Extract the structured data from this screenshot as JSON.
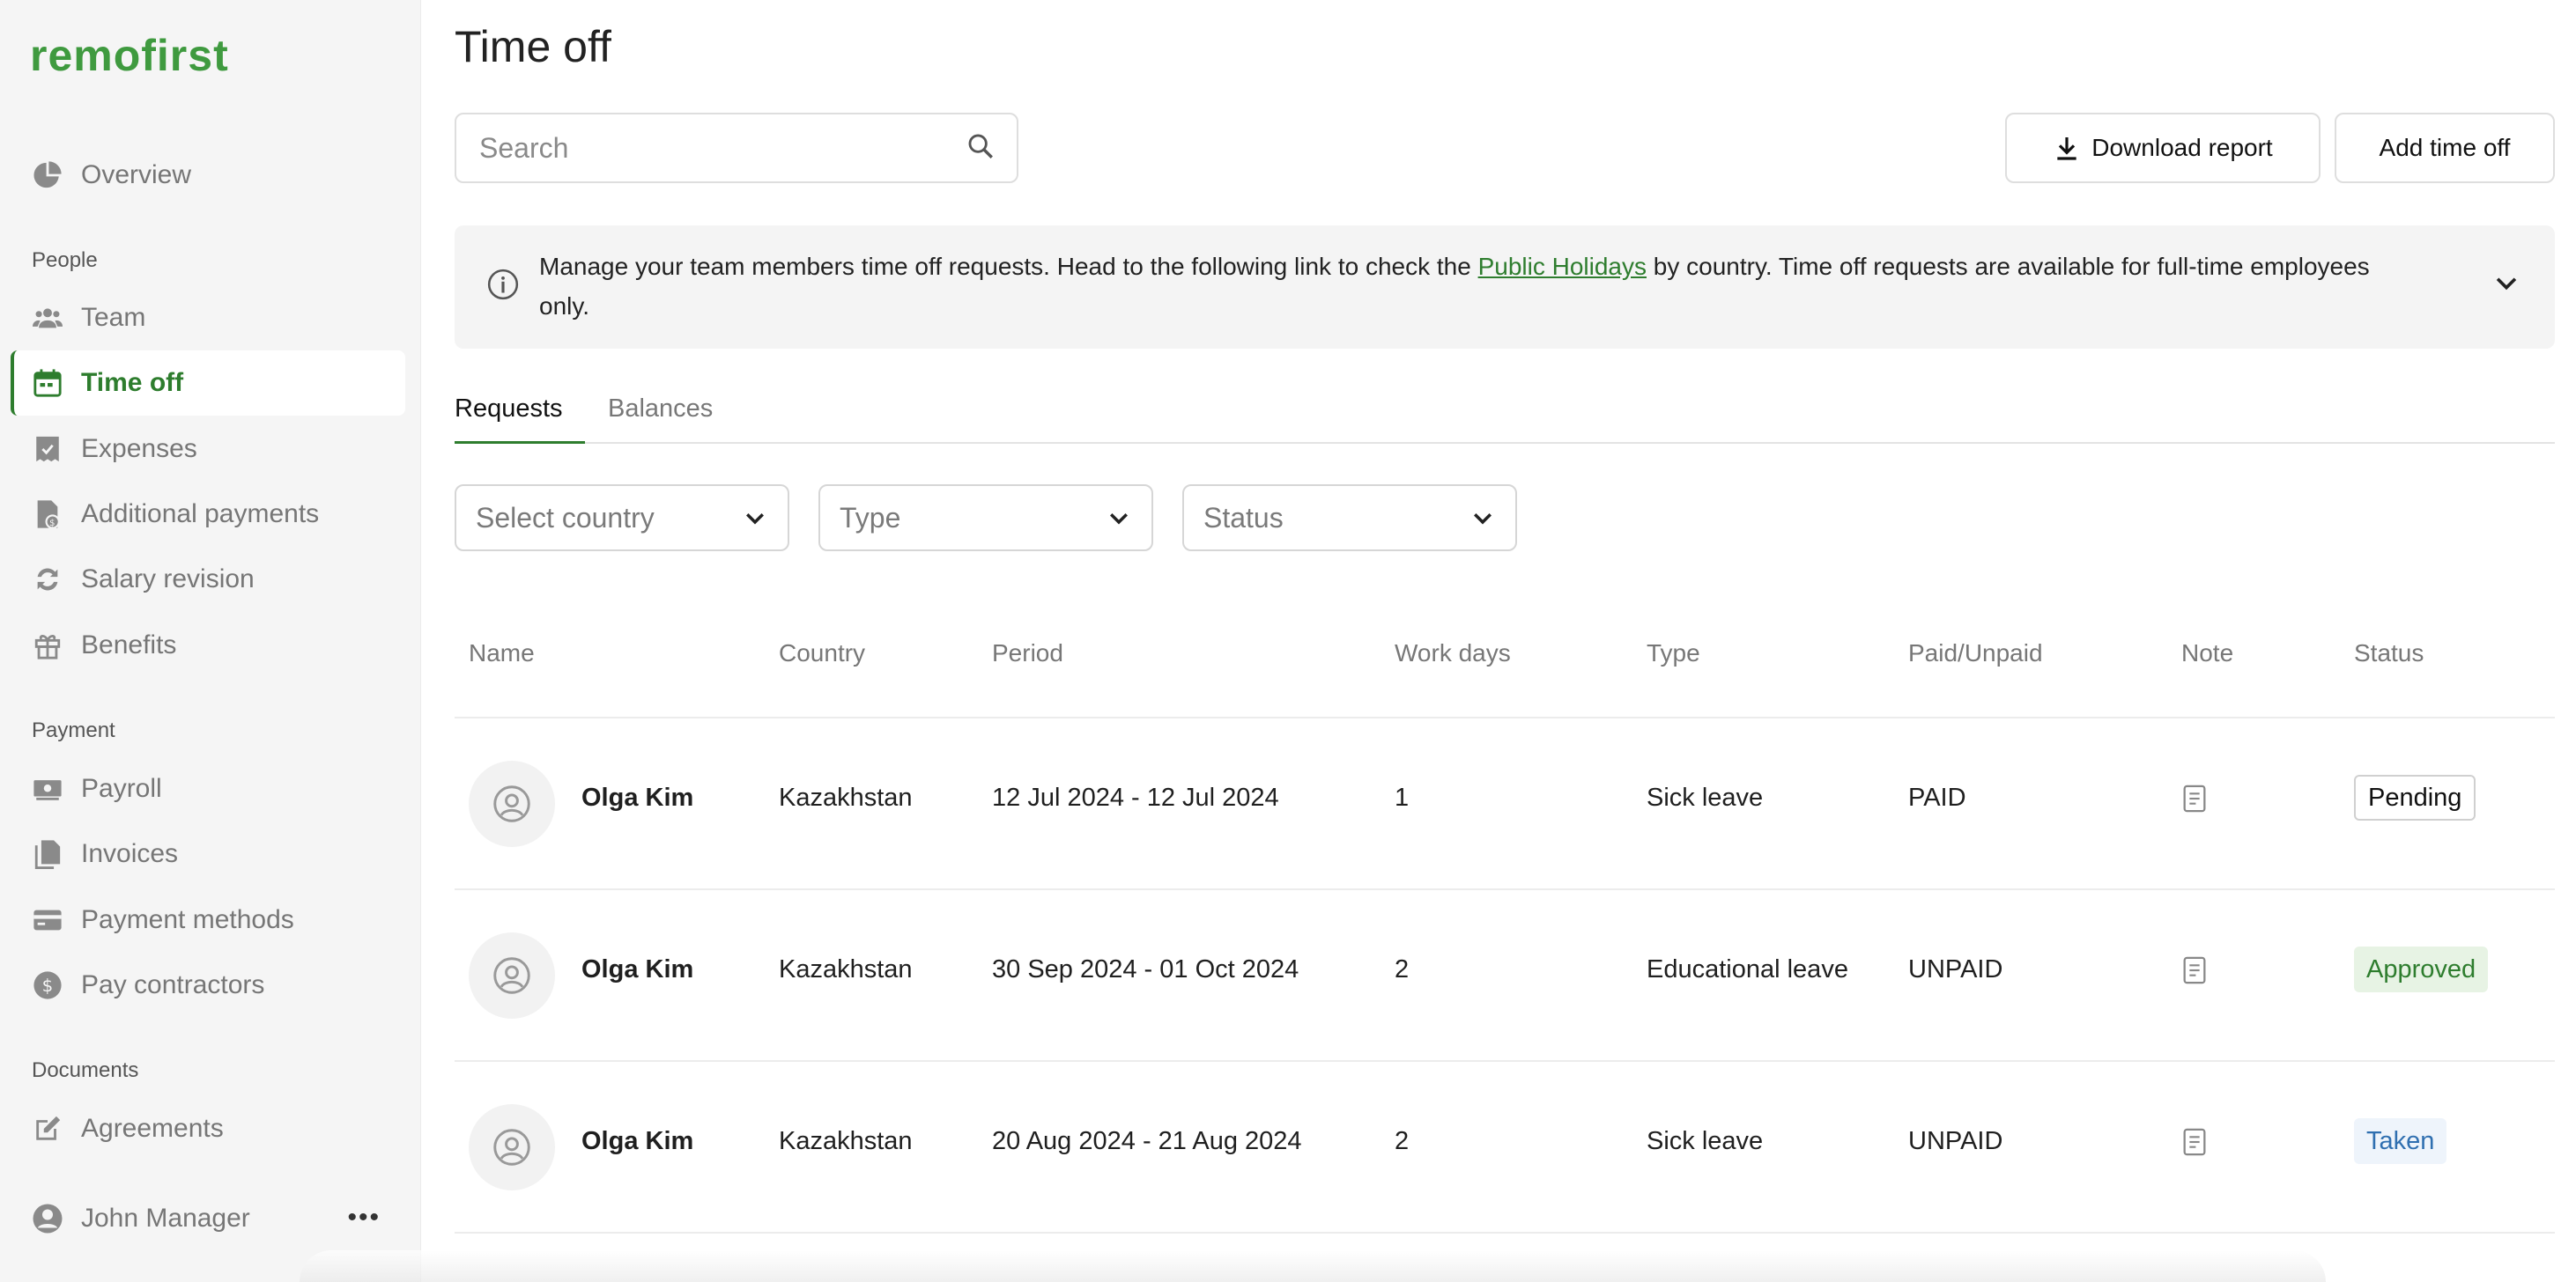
{
  "app": {
    "logo": "remofirst",
    "brand_color": "#3f9a3f"
  },
  "sidebar": {
    "items": [
      {
        "label": "Overview",
        "icon": "pie-chart-icon"
      },
      {
        "label": "Team",
        "icon": "team-icon"
      },
      {
        "label": "Time off",
        "icon": "calendar-icon",
        "active": true
      },
      {
        "label": "Expenses",
        "icon": "receipt-icon"
      },
      {
        "label": "Additional payments",
        "icon": "document-dollar-icon"
      },
      {
        "label": "Salary revision",
        "icon": "refresh-icon"
      },
      {
        "label": "Benefits",
        "icon": "gift-icon"
      },
      {
        "label": "Payroll",
        "icon": "cash-icon"
      },
      {
        "label": "Invoices",
        "icon": "invoice-icon"
      },
      {
        "label": "Payment methods",
        "icon": "credit-card-icon"
      },
      {
        "label": "Pay contractors",
        "icon": "dollar-circle-icon"
      },
      {
        "label": "Agreements",
        "icon": "edit-icon"
      }
    ],
    "sections": {
      "people": "People",
      "payment": "Payment",
      "documents": "Documents"
    },
    "user": {
      "name": "John Manager",
      "more": "•••"
    }
  },
  "header": {
    "title": "Time off",
    "search_placeholder": "Search",
    "download_label": "Download report",
    "add_label": "Add time off"
  },
  "banner": {
    "text_before": "Manage your team members time off requests. Head to the following link to check the ",
    "link": "Public Holidays",
    "text_after": " by country. Time off requests are available for full-time employees only."
  },
  "tabs": {
    "requests": "Requests",
    "balances": "Balances"
  },
  "filters": {
    "country": "Select country",
    "type": "Type",
    "status": "Status"
  },
  "table": {
    "headers": {
      "name": "Name",
      "country": "Country",
      "period": "Period",
      "days": "Work days",
      "type": "Type",
      "paid": "Paid/Unpaid",
      "note": "Note",
      "status": "Status"
    },
    "rows": [
      {
        "name": "Olga Kim",
        "country": "Kazakhstan",
        "period": "12 Jul 2024 - 12 Jul 2024",
        "days": "1",
        "type": "Sick leave",
        "paid": "PAID",
        "status": "Pending"
      },
      {
        "name": "Olga Kim",
        "country": "Kazakhstan",
        "period": "30 Sep 2024 - 01 Oct 2024",
        "days": "2",
        "type": "Educational leave",
        "paid": "UNPAID",
        "status": "Approved"
      },
      {
        "name": "Olga Kim",
        "country": "Kazakhstan",
        "period": "20 Aug 2024 - 21 Aug 2024",
        "days": "2",
        "type": "Sick leave",
        "paid": "UNPAID",
        "status": "Taken"
      }
    ]
  }
}
